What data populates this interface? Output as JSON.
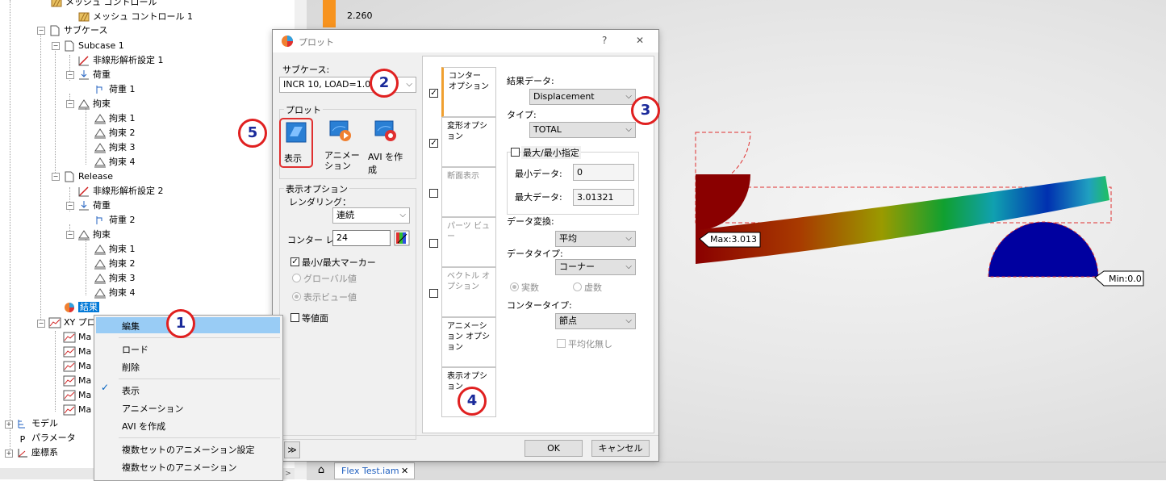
{
  "tree": {
    "mesh_control": "メッシュ コントロール",
    "mesh_control_1": "メッシュ コントロール 1",
    "subcase_group": "サブケース",
    "subcase1": "Subcase 1",
    "nonlinear1": "非線形解析設定 1",
    "load_group1": "荷重",
    "load1": "荷重 1",
    "constraint_group1": "拘束",
    "constraints1": [
      "拘束 1",
      "拘束 2",
      "拘束 3",
      "拘束 4"
    ],
    "release": "Release",
    "nonlinear2": "非線形解析設定 2",
    "load_group2": "荷重",
    "load2": "荷重 2",
    "constraint_group2": "拘束",
    "constraints2": [
      "拘束 1",
      "拘束 2",
      "拘束 3",
      "拘束 4"
    ],
    "results": "結果",
    "xy_plot": "XY プロ",
    "xy_items": [
      "Ma",
      "Ma",
      "Ma",
      "Ma",
      "Ma",
      "Ma"
    ],
    "model": "モデル",
    "parameters": "パラメータ",
    "coords": "座標系"
  },
  "context_menu": {
    "edit": "編集",
    "load": "ロード",
    "delete": "削除",
    "show": "表示",
    "animation": "アニメーション",
    "create_avi": "AVI を作成",
    "multi_anim_settings": "複数セットのアニメーション設定",
    "multi_anim": "複数セットのアニメーション"
  },
  "legend_value": "2.260",
  "dialog": {
    "title": "プロット",
    "help": "?",
    "close": "✕",
    "subcase_label": "サブケース:",
    "subcase_value": "INCR 10, LOAD=1.0",
    "plot_group": "プロット",
    "btn_show": "表示",
    "btn_animation": "アニメーション",
    "btn_avi": "AVI を作成",
    "display_options": "表示オプション",
    "rendering_label": "レンダリング：",
    "rendering_value": "連続",
    "contour_label": "コンター レ",
    "contour_value": "24",
    "minmax_marker": "最小/最大マーカー",
    "global_value": "グローバル値",
    "display_view_value": "表示ビュー値",
    "isosurface": "等値面",
    "tabs": [
      "コンター オプション",
      "変形オプション",
      "断面表示",
      "パーツ ビュー",
      "ベクトル オプション",
      "アニメーション オプション",
      "表示オプション"
    ],
    "result_data_label": "結果データ:",
    "result_data_value": "Displacement",
    "type_label": "タイプ:",
    "type_value": "TOTAL",
    "minmax_spec": "最大/最小指定",
    "min_data_label": "最小データ:",
    "min_data_value": "0",
    "max_data_label": "最大データ:",
    "max_data_value": "3.01321",
    "data_conv_label": "データ変換:",
    "data_conv_value": "平均",
    "data_type_label": "データタイプ:",
    "data_type_value": "コーナー",
    "real": "実数",
    "imag": "虚数",
    "contour_type_label": "コンタータイプ:",
    "contour_type_value": "節点",
    "no_average": "平均化無し",
    "ok": "OK",
    "cancel": "キャンセル",
    "collapse": "≫"
  },
  "viewport": {
    "max_label": "Max:3.013",
    "min_label": "Min:0.0",
    "tab_title": "Flex Test.iam",
    "tab_close": "✕"
  },
  "markers": [
    "1",
    "2",
    "3",
    "4",
    "5"
  ]
}
